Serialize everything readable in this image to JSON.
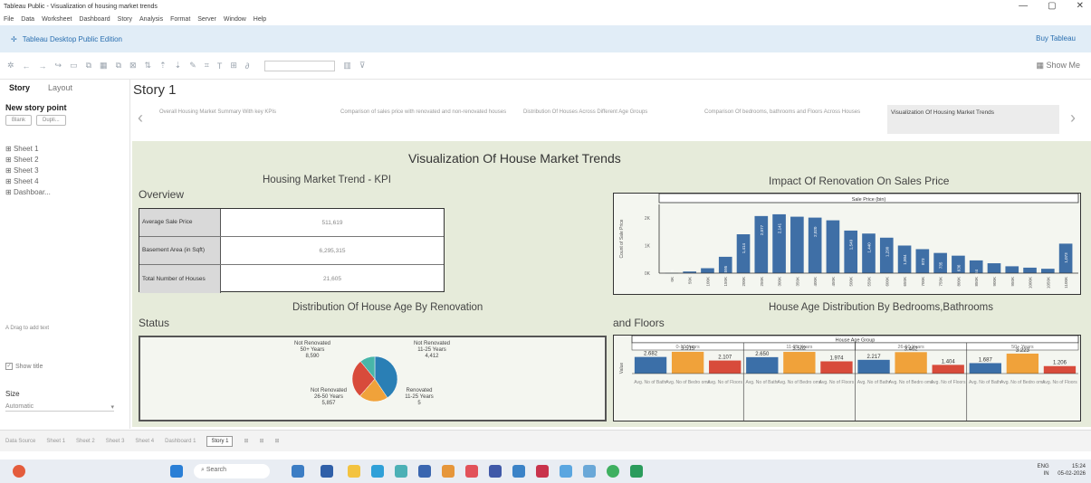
{
  "window": {
    "title": "Tableau Public - Visualization of housing market trends",
    "controls": [
      "—",
      "▢",
      "✕"
    ]
  },
  "menu": [
    "File",
    "Data",
    "Worksheet",
    "Dashboard",
    "Story",
    "Analysis",
    "Format",
    "Server",
    "Window",
    "Help"
  ],
  "edition": {
    "label": "Tableau Desktop Public Edition",
    "buy": "Buy Tableau"
  },
  "toolbar": {
    "show_me": "Show Me"
  },
  "left_pane": {
    "tabs": [
      "Story",
      "Layout"
    ],
    "new_story_point": "New story point",
    "buttons": [
      "Blank",
      "Dupli..."
    ],
    "sheets": [
      "Sheet 1",
      "Sheet 2",
      "Sheet 3",
      "Sheet 4",
      "Dashboar..."
    ],
    "drag_text": "Drag to add text",
    "show_title": "Show title",
    "size_label": "Size",
    "size_value": "Automatic"
  },
  "story": {
    "title": "Story 1",
    "points": [
      "Overall Housing Market Summary With key KPIs",
      "Comparison of sales price with renovated and non-renovated houses",
      "Distribution Of Houses Across Different Age Groups",
      "Comparison Of bedrooms, bathrooms and Floors Across Houses",
      "Visualization Of Housing Market Trends"
    ]
  },
  "dashboard": {
    "title": "Visualization Of House Market Trends",
    "kpi_title": "Housing Market Trend - KPI",
    "overview": "Overview",
    "kpis": [
      {
        "label": "Average Sale Price",
        "value": "511,619"
      },
      {
        "label": "Basement Area (in Sqft)",
        "value": "6,295,315"
      },
      {
        "label": "Total Number of Houses",
        "value": "21,605"
      }
    ],
    "renovation_title": "Impact Of Renovation On Sales Price",
    "age_renov_title": "Distribution Of House Age By Renovation",
    "status": "Status",
    "bbf_title": "House Age Distribution By Bedrooms,Bathrooms",
    "and_floors": "and Floors"
  },
  "chart_data": [
    {
      "type": "bar",
      "header": "Sale Price (bin)",
      "ylabel": "Count of Sale Price",
      "yticks": [
        "2K",
        "1K",
        "0K"
      ],
      "ylim": [
        0,
        2500
      ],
      "categories": [
        "0K",
        "50K",
        "100K",
        "150K",
        "200K",
        "250K",
        "300K",
        "350K",
        "400K",
        "450K",
        "500K",
        "550K",
        "600K",
        "650K",
        "700K",
        "750K",
        "800K",
        "850K",
        "900K",
        "950K",
        "1000K",
        "1050K",
        "1100K"
      ],
      "values": [
        5,
        60,
        180,
        595,
        1414,
        2077,
        2141,
        2053,
        2020,
        1922,
        1549,
        1440,
        1290,
        1004,
        873,
        735,
        636,
        464,
        360,
        250,
        200,
        160,
        1073
      ],
      "labels": [
        "5",
        "",
        "",
        "595",
        "1,414",
        "2,077",
        "2,141",
        "",
        "2,020",
        "",
        "1,549",
        "1,440",
        "1,290",
        "1,004",
        "873",
        "735",
        "636",
        "464",
        "",
        "",
        "",
        "",
        "1,073"
      ]
    },
    {
      "type": "pie",
      "slices": [
        {
          "label": "Not Renovated 50+ Years",
          "value": 8590,
          "display": "8,590",
          "color": "#2a7fb5"
        },
        {
          "label": "Not Renovated 11-25 Years",
          "value": 4412,
          "display": "4,412",
          "color": "#f0a23a"
        },
        {
          "label": "Renovated 11-25 Years",
          "value": 5,
          "display": "5",
          "color": "#6a9e3a"
        },
        {
          "label": "Not Renovated 26-50 Years",
          "value": 5857,
          "display": "5,857",
          "color": "#d84b3b"
        },
        {
          "label": "",
          "value": 2300,
          "display": "",
          "color": "#48b6a8"
        }
      ],
      "labels": [
        {
          "l1": "Not Renovated",
          "l2": "50+ Years",
          "l3": "8,590"
        },
        {
          "l1": "Not Renovated",
          "l2": "11-25 Years",
          "l3": "4,412"
        },
        {
          "l1": "Not Renovated",
          "l2": "26-50 Years",
          "l3": "5,857"
        },
        {
          "l1": "Renovated",
          "l2": "11-25 Years",
          "l3": "5"
        }
      ]
    },
    {
      "type": "bar",
      "header": "House Age Group",
      "ylabel": "Value",
      "groups": [
        "0-10 Years",
        "11-25 Years",
        "26-50 Years",
        "50+ Years"
      ],
      "measures": [
        "Avg. No of Bathrooms",
        "Avg. No of Bedrooms",
        "Avg. No of Floors"
      ],
      "series_colors": [
        "#3b6fa8",
        "#f0a23a",
        "#d84b3b"
      ],
      "values": [
        [
          2.682,
          3.515,
          2.107
        ],
        [
          2.65,
          3.502,
          1.974
        ],
        [
          2.217,
          3.462,
          1.404
        ],
        [
          1.687,
          3.223,
          1.206
        ]
      ],
      "labels": [
        [
          "2.682",
          "3.515",
          "2.107"
        ],
        [
          "2.650",
          "3.502",
          "1.974"
        ],
        [
          "2.217",
          "3.462",
          "1.404"
        ],
        [
          "1.687",
          "3.223",
          "1.206"
        ]
      ],
      "footer": [
        "Avg. No of Bathr",
        "Avg. No of Bedro oms",
        "Avg. No of Floors"
      ]
    }
  ],
  "statusbar": [
    "Data Source",
    "Sheet 1",
    "Sheet 2",
    "Sheet 3",
    "Sheet 4",
    "Dashboard 1",
    "Story 1"
  ],
  "taskbar": {
    "search": "Search",
    "lang": "ENG",
    "region": "IN",
    "time": "15:24",
    "date": "05-02-2026"
  }
}
